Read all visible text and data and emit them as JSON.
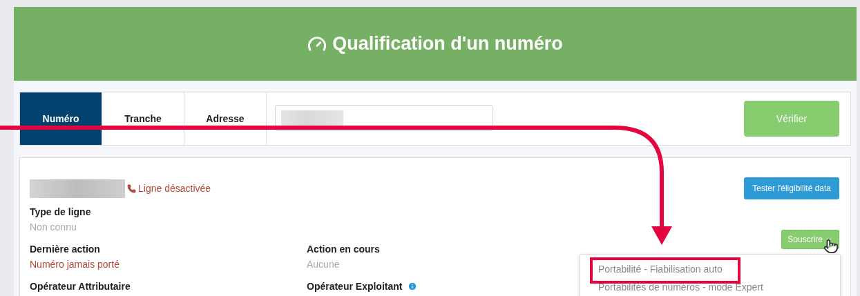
{
  "header": {
    "title": "Qualification d'un numéro"
  },
  "tabs": [
    {
      "label": "Numéro",
      "selected": true
    },
    {
      "label": "Tranche",
      "selected": false
    },
    {
      "label": "Adresse",
      "selected": false
    }
  ],
  "verify_button": "Vérifier",
  "line_status": "Ligne désactivée",
  "eligibility_button": "Tester l'éligibilité data",
  "fields": [
    [
      {
        "label": "Type de ligne",
        "value": "Non connu",
        "kind": "muted"
      }
    ],
    [
      {
        "label": "Dernière action",
        "value": "Numéro jamais porté",
        "kind": "alert"
      },
      {
        "label": "Action en cours",
        "value": "Aucune",
        "kind": "muted"
      }
    ],
    [
      {
        "label": "Opérateur Attributaire"
      },
      {
        "label": "Opérateur Exploitant",
        "info": true
      }
    ]
  ],
  "subscribe_button": "Souscrire",
  "dropdown": [
    {
      "label": "Portabilité - Fiabilisation auto",
      "annotated": true
    },
    {
      "label": "Portabilités de numéros - mode Expert",
      "annotated": false
    }
  ]
}
